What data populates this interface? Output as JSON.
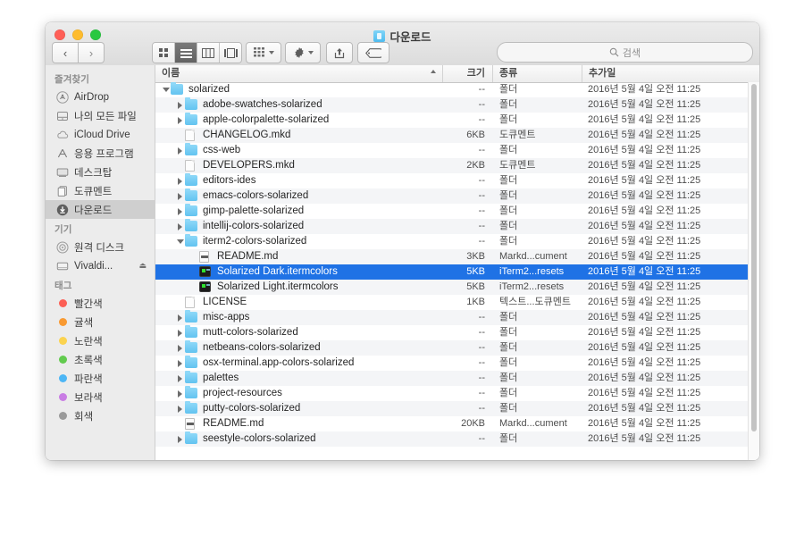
{
  "window": {
    "title": "다운로드",
    "title_icon": "downloads-folder-icon",
    "traffic_lights": [
      "close",
      "minimize",
      "zoom"
    ]
  },
  "toolbar": {
    "back_label": "‹",
    "forward_label": "›",
    "view_modes": [
      {
        "name": "icon-view",
        "active": false
      },
      {
        "name": "list-view",
        "active": true
      },
      {
        "name": "column-view",
        "active": false
      },
      {
        "name": "coverflow-view",
        "active": false
      }
    ],
    "arrange_label": "arrange-icon",
    "action_label": "gear-icon",
    "share_label": "share-icon",
    "tag_label": "tag-icon"
  },
  "search": {
    "placeholder": "검색",
    "icon": "search-icon",
    "value": ""
  },
  "sidebar": {
    "sections": [
      {
        "header": "즐겨찾기",
        "items": [
          {
            "label": "AirDrop",
            "icon": "airdrop-icon",
            "selected": false
          },
          {
            "label": "나의 모든 파일",
            "icon": "all-files-icon",
            "selected": false
          },
          {
            "label": "iCloud Drive",
            "icon": "icloud-icon",
            "selected": false
          },
          {
            "label": "응용 프로그램",
            "icon": "applications-icon",
            "selected": false
          },
          {
            "label": "데스크탑",
            "icon": "desktop-icon",
            "selected": false
          },
          {
            "label": "도큐멘트",
            "icon": "documents-icon",
            "selected": false
          },
          {
            "label": "다운로드",
            "icon": "downloads-icon",
            "selected": true
          }
        ]
      },
      {
        "header": "기기",
        "items": [
          {
            "label": "원격 디스크",
            "icon": "remote-disc-icon",
            "selected": false
          },
          {
            "label": "Vivaldi...",
            "icon": "external-disk-icon",
            "selected": false,
            "eject": "⏏"
          }
        ]
      },
      {
        "header": "태그",
        "items": [
          {
            "label": "빨간색",
            "icon": "tag-dot-icon",
            "color": "#fc5f55",
            "selected": false
          },
          {
            "label": "귤색",
            "icon": "tag-dot-icon",
            "color": "#f99a32",
            "selected": false
          },
          {
            "label": "노란색",
            "icon": "tag-dot-icon",
            "color": "#fbd34f",
            "selected": false
          },
          {
            "label": "초록색",
            "icon": "tag-dot-icon",
            "color": "#62cb4e",
            "selected": false
          },
          {
            "label": "파란색",
            "icon": "tag-dot-icon",
            "color": "#4db6f5",
            "selected": false
          },
          {
            "label": "보라색",
            "icon": "tag-dot-icon",
            "color": "#c97de4",
            "selected": false
          },
          {
            "label": "회색",
            "icon": "tag-dot-icon",
            "color": "#9a9a9a",
            "selected": false
          }
        ]
      }
    ]
  },
  "filelist": {
    "columns": [
      {
        "key": "name",
        "label": "이름",
        "sorted": "asc"
      },
      {
        "key": "size",
        "label": "크기"
      },
      {
        "key": "kind",
        "label": "종류"
      },
      {
        "key": "date",
        "label": "추가일"
      }
    ],
    "rows": [
      {
        "name": "solarized",
        "indent": 0,
        "disclosure": "open",
        "icon": "folder-icon",
        "size": "--",
        "kind": "폴더",
        "date": "2016년 5월 4일 오전 11:25",
        "selected": false
      },
      {
        "name": "adobe-swatches-solarized",
        "indent": 1,
        "disclosure": "closed",
        "icon": "folder-icon",
        "size": "--",
        "kind": "폴더",
        "date": "2016년 5월 4일 오전 11:25",
        "selected": false
      },
      {
        "name": "apple-colorpalette-solarized",
        "indent": 1,
        "disclosure": "closed",
        "icon": "folder-icon",
        "size": "--",
        "kind": "폴더",
        "date": "2016년 5월 4일 오전 11:25",
        "selected": false
      },
      {
        "name": "CHANGELOG.mkd",
        "indent": 1,
        "disclosure": "none",
        "icon": "document-icon",
        "size": "6KB",
        "kind": "도큐멘트",
        "date": "2016년 5월 4일 오전 11:25",
        "selected": false
      },
      {
        "name": "css-web",
        "indent": 1,
        "disclosure": "closed",
        "icon": "folder-icon",
        "size": "--",
        "kind": "폴더",
        "date": "2016년 5월 4일 오전 11:25",
        "selected": false
      },
      {
        "name": "DEVELOPERS.mkd",
        "indent": 1,
        "disclosure": "none",
        "icon": "document-icon",
        "size": "2KB",
        "kind": "도큐멘트",
        "date": "2016년 5월 4일 오전 11:25",
        "selected": false
      },
      {
        "name": "editors-ides",
        "indent": 1,
        "disclosure": "closed",
        "icon": "folder-icon",
        "size": "--",
        "kind": "폴더",
        "date": "2016년 5월 4일 오전 11:25",
        "selected": false
      },
      {
        "name": "emacs-colors-solarized",
        "indent": 1,
        "disclosure": "closed",
        "icon": "folder-icon",
        "size": "--",
        "kind": "폴더",
        "date": "2016년 5월 4일 오전 11:25",
        "selected": false
      },
      {
        "name": "gimp-palette-solarized",
        "indent": 1,
        "disclosure": "closed",
        "icon": "folder-icon",
        "size": "--",
        "kind": "폴더",
        "date": "2016년 5월 4일 오전 11:25",
        "selected": false
      },
      {
        "name": "intellij-colors-solarized",
        "indent": 1,
        "disclosure": "closed",
        "icon": "folder-icon",
        "size": "--",
        "kind": "폴더",
        "date": "2016년 5월 4일 오전 11:25",
        "selected": false
      },
      {
        "name": "iterm2-colors-solarized",
        "indent": 1,
        "disclosure": "open",
        "icon": "folder-icon",
        "size": "--",
        "kind": "폴더",
        "date": "2016년 5월 4일 오전 11:25",
        "selected": false
      },
      {
        "name": "README.md",
        "indent": 2,
        "disclosure": "none",
        "icon": "markdown-icon",
        "size": "3KB",
        "kind": "Markd...cument",
        "date": "2016년 5월 4일 오전 11:25",
        "selected": false
      },
      {
        "name": "Solarized Dark.itermcolors",
        "indent": 2,
        "disclosure": "none",
        "icon": "itermcolors-icon",
        "size": "5KB",
        "kind": "iTerm2...resets",
        "date": "2016년 5월 4일 오전 11:25",
        "selected": true
      },
      {
        "name": "Solarized Light.itermcolors",
        "indent": 2,
        "disclosure": "none",
        "icon": "itermcolors-icon",
        "size": "5KB",
        "kind": "iTerm2...resets",
        "date": "2016년 5월 4일 오전 11:25",
        "selected": false
      },
      {
        "name": "LICENSE",
        "indent": 1,
        "disclosure": "none",
        "icon": "document-icon",
        "size": "1KB",
        "kind": "텍스트...도큐멘트",
        "date": "2016년 5월 4일 오전 11:25",
        "selected": false
      },
      {
        "name": "misc-apps",
        "indent": 1,
        "disclosure": "closed",
        "icon": "folder-icon",
        "size": "--",
        "kind": "폴더",
        "date": "2016년 5월 4일 오전 11:25",
        "selected": false
      },
      {
        "name": "mutt-colors-solarized",
        "indent": 1,
        "disclosure": "closed",
        "icon": "folder-icon",
        "size": "--",
        "kind": "폴더",
        "date": "2016년 5월 4일 오전 11:25",
        "selected": false
      },
      {
        "name": "netbeans-colors-solarized",
        "indent": 1,
        "disclosure": "closed",
        "icon": "folder-icon",
        "size": "--",
        "kind": "폴더",
        "date": "2016년 5월 4일 오전 11:25",
        "selected": false
      },
      {
        "name": "osx-terminal.app-colors-solarized",
        "indent": 1,
        "disclosure": "closed",
        "icon": "folder-icon",
        "size": "--",
        "kind": "폴더",
        "date": "2016년 5월 4일 오전 11:25",
        "selected": false
      },
      {
        "name": "palettes",
        "indent": 1,
        "disclosure": "closed",
        "icon": "folder-icon",
        "size": "--",
        "kind": "폴더",
        "date": "2016년 5월 4일 오전 11:25",
        "selected": false
      },
      {
        "name": "project-resources",
        "indent": 1,
        "disclosure": "closed",
        "icon": "folder-icon",
        "size": "--",
        "kind": "폴더",
        "date": "2016년 5월 4일 오전 11:25",
        "selected": false
      },
      {
        "name": "putty-colors-solarized",
        "indent": 1,
        "disclosure": "closed",
        "icon": "folder-icon",
        "size": "--",
        "kind": "폴더",
        "date": "2016년 5월 4일 오전 11:25",
        "selected": false
      },
      {
        "name": "README.md",
        "indent": 1,
        "disclosure": "none",
        "icon": "markdown-icon",
        "size": "20KB",
        "kind": "Markd...cument",
        "date": "2016년 5월 4일 오전 11:25",
        "selected": false
      },
      {
        "name": "seestyle-colors-solarized",
        "indent": 1,
        "disclosure": "closed",
        "icon": "folder-icon",
        "size": "--",
        "kind": "폴더",
        "date": "2016년 5월 4일 오전 11:25",
        "selected": false
      }
    ]
  },
  "colors": {
    "selection_blue": "#1f72e5",
    "sidebar_bg": "#ececec",
    "folder_blue": "#62c3f0"
  }
}
